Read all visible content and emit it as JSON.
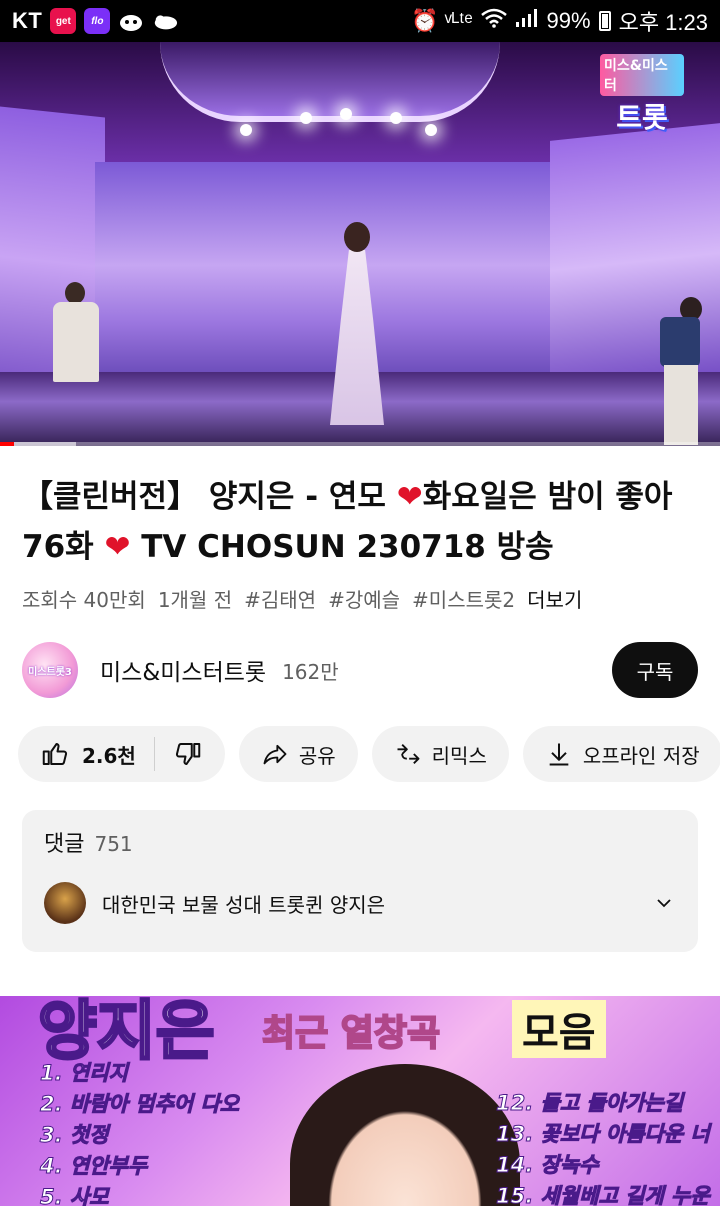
{
  "status_bar": {
    "carrier": "KT",
    "app_get": "get",
    "app_flo": "flo",
    "right_icons": "⏰ ᵛᴸᵗᵉ",
    "battery": "99%",
    "time": "오후 1:23"
  },
  "video": {
    "logo_line1": "미스&미스터",
    "logo_line2": "트롯",
    "progress_fraction": 0.02,
    "buffer_fraction": 0.105
  },
  "title": {
    "part1": "【클린버전】 양지은 - 연모 ",
    "heart1": "❤",
    "part2": "화요일은 밤이 좋아 76화 ",
    "heart2": "❤",
    "part3": " TV CHOSUN 230718 방송"
  },
  "meta": {
    "views": "조회수 40만회",
    "age": "1개월 전",
    "tags": [
      "#김태연",
      "#강예슬",
      "#미스트롯2"
    ],
    "more": "더보기"
  },
  "channel": {
    "avatar_text": "미스트롯3",
    "name": "미스&미스터트롯",
    "subs": "162만",
    "subscribe": "구독"
  },
  "actions": {
    "likes": "2.6천",
    "share": "공유",
    "remix": "리믹스",
    "offline": "오프라인 저장"
  },
  "comments": {
    "label": "댓글",
    "count": "751",
    "top_comment": "대한민국 보물 성대 트롯퀸 양지은"
  },
  "next_thumb": {
    "title": "양지은",
    "subtitle": "최근 열창곡",
    "box": "모음",
    "left_list": [
      "1. 연리지",
      "2. 바람아 멈추어 다오",
      "3. 첫정",
      "4. 연안부두",
      "5. 사모"
    ],
    "right_list": [
      "12. 돌고 돌아가는길",
      "13. 꽃보다 아름다운 너",
      "14. 장녹수",
      "15. 세월베고 길게 누운"
    ]
  },
  "colors": {
    "accent_red": "#ff0000",
    "heart": "#e0132a",
    "chip_bg": "#f2f2f2",
    "text_primary": "#0f0f0f",
    "text_secondary": "#606060"
  }
}
